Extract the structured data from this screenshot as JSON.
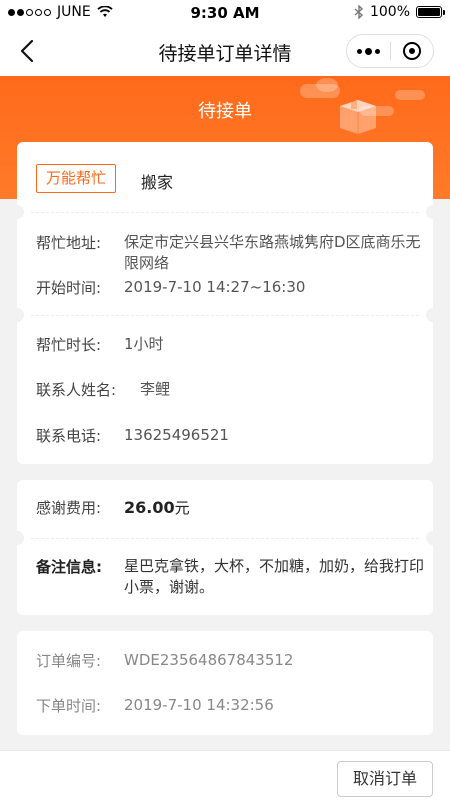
{
  "status_bar": {
    "carrier": "JUNE",
    "time": "9:30 AM",
    "battery": "100%",
    "battery_level": 1.0
  },
  "nav": {
    "title": "待接单订单详情"
  },
  "banner": {
    "status": "待接单"
  },
  "service": {
    "category_tag": "万能帮忙",
    "name": "搬家"
  },
  "details": {
    "address_label": "帮忙地址:",
    "address_value": "保定市定兴县兴华东路燕城隽府D区底商乐无限网络",
    "start_label": "开始时间:",
    "start_value": "2019-7-10 14:27~16:30",
    "duration_label": "帮忙时长:",
    "duration_value": "1小时",
    "contact_label": "联系人姓名:",
    "contact_value": "李鲤",
    "phone_label": "联系电话:",
    "phone_value": "13625496521"
  },
  "fee": {
    "fee_label": "感谢费用:",
    "fee_amount": "26.00",
    "fee_unit": "元",
    "remark_label": "备注信息:",
    "remark_value": "星巴克拿铁，大杯，不加糖，加奶，给我打印小票，谢谢。"
  },
  "order": {
    "number_label": "订单编号:",
    "number_value": "WDE23564867843512",
    "time_label": "下单时间:",
    "time_value": "2019-7-10 14:32:56"
  },
  "actions": {
    "cancel_label": "取消订单"
  },
  "colors": {
    "accent": "#ff6a1a",
    "background": "#f2f2f2"
  }
}
